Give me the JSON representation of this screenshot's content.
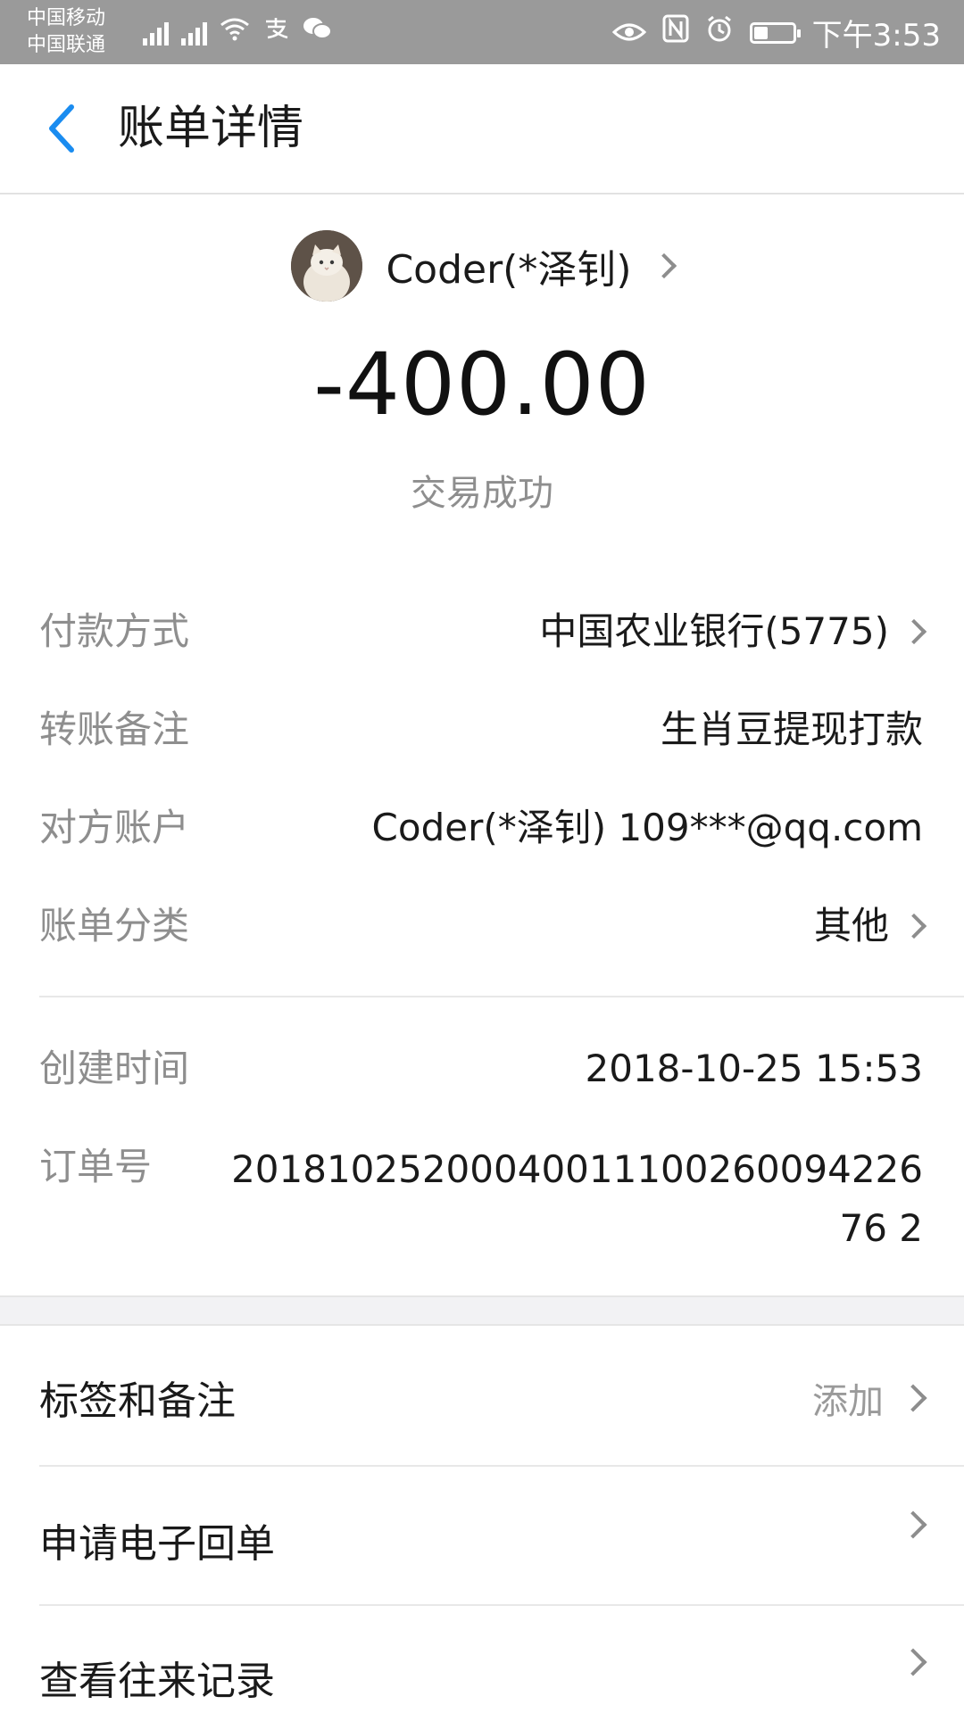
{
  "status_bar": {
    "carrier1": "中国移动",
    "carrier2": "中国联通",
    "time": "下午3:53",
    "battery_level": 0.35
  },
  "header": {
    "title": "账单详情"
  },
  "payee": {
    "name": "Coder(*泽钊)"
  },
  "amount": "-400.00",
  "status": "交易成功",
  "details": {
    "payment_method": {
      "label": "付款方式",
      "value": "中国农业银行(5775)"
    },
    "transfer_note": {
      "label": "转账备注",
      "value": "生肖豆提现打款"
    },
    "counterparty": {
      "label": "对方账户",
      "value": "Coder(*泽钊) 109***@qq.com"
    },
    "category": {
      "label": "账单分类",
      "value": "其他"
    },
    "created_time": {
      "label": "创建时间",
      "value": "2018-10-25 15:53"
    },
    "order_no": {
      "label": "订单号",
      "value": "2018102520004001110026009422676 2"
    }
  },
  "actions": {
    "tags": {
      "label": "标签和备注",
      "hint": "添加"
    },
    "receipt": {
      "label": "申请电子回单"
    },
    "history": {
      "label": "查看往来记录"
    }
  },
  "colors": {
    "accent": "#1a8cf0",
    "status_bar": "#9a9a9a",
    "label_gray": "#8e8e8e"
  }
}
